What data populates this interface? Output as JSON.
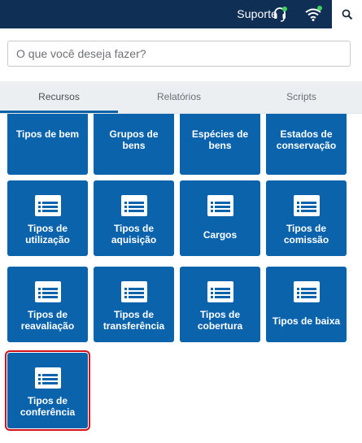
{
  "topbar": {
    "support_label": "Suporte",
    "icons": [
      "headset-icon",
      "wifi-icon",
      "search-icon"
    ],
    "status_color": "#3dd35c"
  },
  "search": {
    "placeholder": "O que você deseja fazer?"
  },
  "tabs": [
    {
      "label": "Recursos",
      "active": true
    },
    {
      "label": "Relatórios",
      "active": false
    },
    {
      "label": "Scripts",
      "active": false
    }
  ],
  "tiles": [
    {
      "label": "Tipos de bem"
    },
    {
      "label": "Grupos de bens"
    },
    {
      "label": "Espécies de bens"
    },
    {
      "label": "Estados de conservação"
    },
    {
      "label": "Tipos de utilização"
    },
    {
      "label": "Tipos de aquisição"
    },
    {
      "label": "Cargos"
    },
    {
      "label": "Tipos de comissão"
    },
    {
      "label": "Tipos de reavaliação"
    },
    {
      "label": "Tipos de transferência"
    },
    {
      "label": "Tipos de cobertura"
    },
    {
      "label": "Tipos de baixa"
    },
    {
      "label": "Tipos de conferência",
      "highlighted": true
    }
  ],
  "colors": {
    "topbar": "#0f2f54",
    "tile": "#0b63ac",
    "highlight_border": "#d1111b",
    "active_tab_underline": "#0b62a6"
  }
}
